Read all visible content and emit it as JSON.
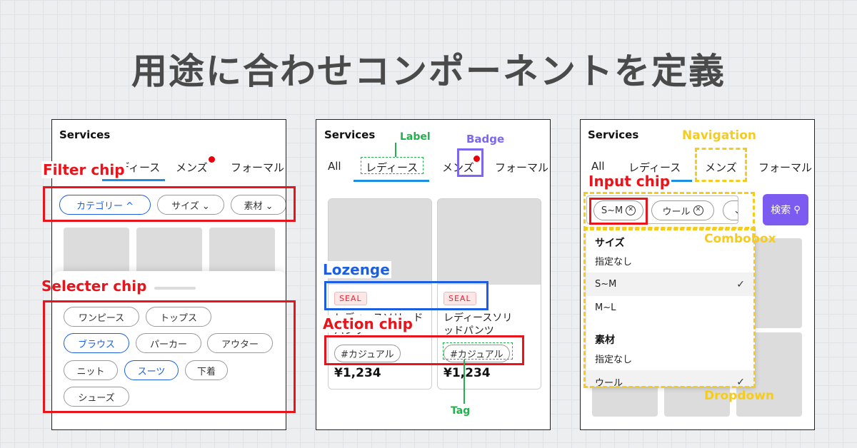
{
  "title": "用途に合わせコンポーネントを定義",
  "panels": {
    "left": {
      "services": "Services",
      "tabs": [
        "レディース",
        "メンズ",
        "フォーマル"
      ],
      "filter_chips": [
        "カテゴリー ^",
        "サイズ ⌄",
        "素材 ⌄"
      ],
      "selector_chips": [
        "ワンピース",
        "トップス",
        "ブラウス",
        "パーカー",
        "アウター",
        "ニット",
        "スーツ",
        "下着",
        "シューズ"
      ],
      "selected": [
        "ブラウス",
        "スーツ"
      ]
    },
    "middle": {
      "services": "Services",
      "tabs": [
        "All",
        "レディース",
        "メンズ",
        "フォーマル"
      ],
      "cards": [
        {
          "seal": "SEAL",
          "name": "レディースソリッドパンツ",
          "tag": "#カジュアル",
          "price": "¥1,234"
        },
        {
          "seal": "SEAL",
          "name": "レディースソリッドパンツ",
          "tag": "#カジュアル",
          "price": "¥1,234"
        }
      ]
    },
    "right": {
      "services": "Services",
      "tabs": [
        "All",
        "レディース",
        "メンズ",
        "フォーマル"
      ],
      "input_chips": [
        "S~M",
        "ウール"
      ],
      "search_label": "検索",
      "dropdown": {
        "size_header": "サイズ",
        "size_options": [
          "指定なし",
          "S~M",
          "M~L"
        ],
        "material_header": "素材",
        "material_options": [
          "指定なし",
          "ウール"
        ],
        "check": "✓"
      }
    }
  },
  "annotations": {
    "filter_chip": "Filter chip",
    "selecter_chip": "Selecter chip",
    "label": "Label",
    "badge": "Badge",
    "lozenge": "Lozenge",
    "action_chip": "Action chip",
    "tag": "Tag",
    "navigation": "Navigation",
    "input_chip": "Input chip",
    "combobox": "Combobox",
    "dropdown": "Dropdown"
  },
  "colors": {
    "annotation_red": "#e8141c",
    "annotation_blue": "#1b5fe0",
    "annotation_green": "#22b14c",
    "annotation_purple": "#7b68ee",
    "annotation_yellow": "#f5cc1e",
    "tab_indicator": "#1c8fe0",
    "badge_dot": "#e8000b",
    "search_button": "#7c5cf0"
  }
}
